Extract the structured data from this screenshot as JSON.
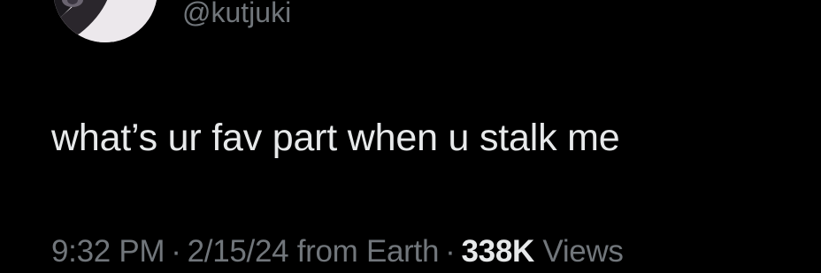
{
  "author": {
    "handle": "@kutjuki",
    "avatar_icon": "profile-photo"
  },
  "tweet": {
    "text": "what’s ur fav part when u stalk me"
  },
  "meta": {
    "time": "9:32 PM",
    "separator": "·",
    "date": "2/15/24",
    "source": "from Earth",
    "views_count": "338K",
    "views_label": "Views"
  },
  "colors": {
    "background": "#000000",
    "primary_text": "#e7e9ea",
    "secondary_text": "#71767b"
  }
}
